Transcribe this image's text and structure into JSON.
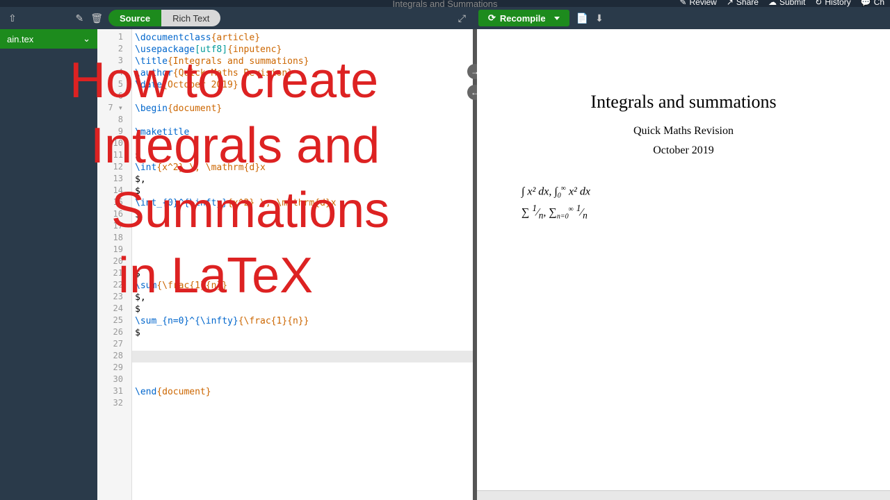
{
  "header": {
    "title": "Integrals and Summations",
    "actions": {
      "review": "Review",
      "share": "Share",
      "submit": "Submit",
      "history": "History",
      "chat": "Ch"
    }
  },
  "tabs": {
    "source": "Source",
    "richtext": "Rich Text"
  },
  "sidebar": {
    "file": "ain.tex"
  },
  "recompile": {
    "label": "Recompile"
  },
  "code_lines": [
    {
      "n": 1,
      "t": "\\documentclass",
      "a": "{article}"
    },
    {
      "n": 2,
      "t": "\\usepackage",
      "o": "[utf8]",
      "a": "{inputenc}"
    },
    {
      "n": 3,
      "t": "\\title",
      "a": "{Integrals and summations}"
    },
    {
      "n": 4,
      "t": "\\author",
      "a": "{Quick Maths Revision}"
    },
    {
      "n": 5,
      "t": "\\date",
      "a": "{October 2019}"
    },
    {
      "n": 6,
      "t": ""
    },
    {
      "n": 7,
      "t": "\\begin",
      "a": "{document}",
      "fold": true
    },
    {
      "n": 8,
      "t": ""
    },
    {
      "n": 9,
      "t": "\\maketitle"
    },
    {
      "n": 10,
      "t": ""
    },
    {
      "n": 11,
      "t": "$"
    },
    {
      "n": 12,
      "t": "\\int",
      "a": "{x^2} \\, \\mathrm{d}x"
    },
    {
      "n": 13,
      "t": "$,"
    },
    {
      "n": 14,
      "t": "$"
    },
    {
      "n": 15,
      "t": "\\int_{0}^{\\infty}",
      "a": "{x^2} \\, \\mathrm{d}x"
    },
    {
      "n": 16,
      "t": "$"
    },
    {
      "n": 17,
      "t": ""
    },
    {
      "n": 18,
      "t": ""
    },
    {
      "n": 19,
      "t": ""
    },
    {
      "n": 20,
      "t": ""
    },
    {
      "n": 21,
      "t": "$"
    },
    {
      "n": 22,
      "t": "\\sum",
      "a": "{\\frac{1}{n}}"
    },
    {
      "n": 23,
      "t": "$,"
    },
    {
      "n": 24,
      "t": "$"
    },
    {
      "n": 25,
      "t": "\\sum_{n=0}^{\\infty}",
      "a": "{\\frac{1}{n}}"
    },
    {
      "n": 26,
      "t": "$"
    },
    {
      "n": 27,
      "t": ""
    },
    {
      "n": 28,
      "t": "",
      "current": true
    },
    {
      "n": 29,
      "t": ""
    },
    {
      "n": 30,
      "t": ""
    },
    {
      "n": 31,
      "t": "\\end",
      "a": "{document}"
    },
    {
      "n": 32,
      "t": ""
    }
  ],
  "preview": {
    "title": "Integrals and summations",
    "author": "Quick Maths Revision",
    "date": "October 2019",
    "math1": "∫ x² dx, ∫₀^∞ x² dx",
    "math2": "∑ 1/n, ∑_{n=0}^∞ 1/n"
  },
  "overlay": {
    "l1": "How to create",
    "l2": "Integrals and",
    "l3": "Summations",
    "l4": "in LaTeX"
  }
}
